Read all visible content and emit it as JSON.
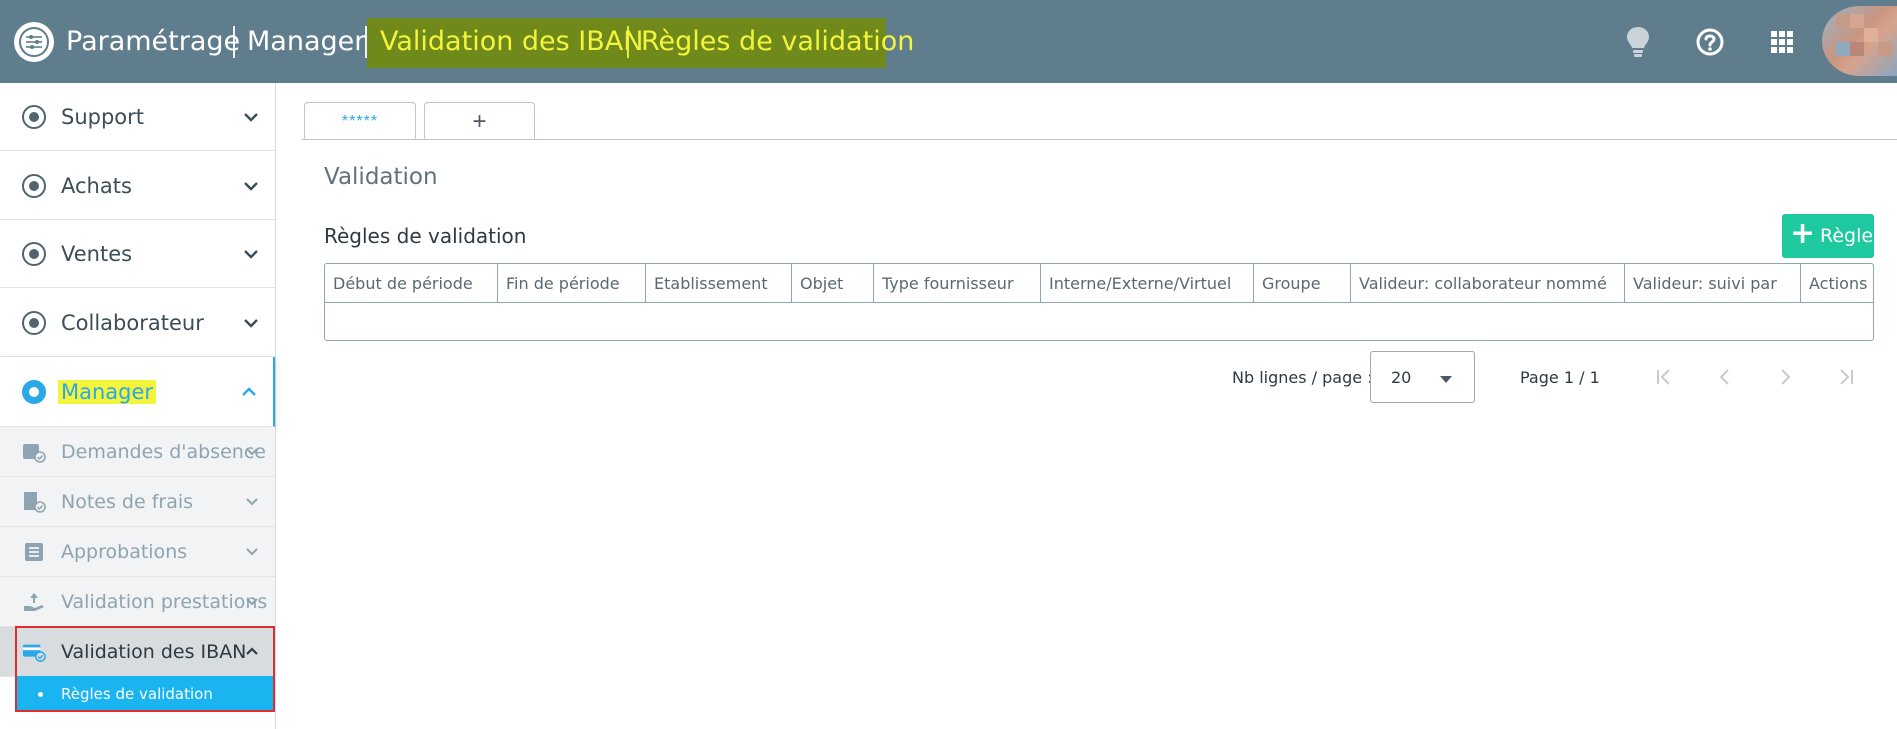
{
  "header": {
    "breadcrumbs": [
      "Paramétrage",
      "Manager",
      "Validation des IBAN",
      "Règles de validation"
    ],
    "icons": [
      "settings-logo-icon",
      "lightbulb-icon",
      "help-icon",
      "apps-grid-icon"
    ]
  },
  "sidebar": {
    "items": [
      {
        "label": "Support",
        "icon": "support-icon"
      },
      {
        "label": "Achats",
        "icon": "purchases-icon"
      },
      {
        "label": "Ventes",
        "icon": "sales-icon"
      },
      {
        "label": "Collaborateur",
        "icon": "user-icon"
      },
      {
        "label": "Manager",
        "icon": "manager-icon"
      }
    ],
    "subitems": [
      {
        "label": "Demandes d'absence",
        "icon": "calendar-check-icon"
      },
      {
        "label": "Notes de frais",
        "icon": "receipt-check-icon"
      },
      {
        "label": "Approbations",
        "icon": "checklist-icon"
      },
      {
        "label": "Validation prestations",
        "icon": "hand-upload-icon"
      },
      {
        "label": "Validation des IBAN",
        "icon": "card-check-icon"
      }
    ],
    "active_leaf": "Règles de validation"
  },
  "tabs": {
    "active": "*****",
    "add": "+"
  },
  "main": {
    "title": "Validation",
    "section": "Règles de validation",
    "add_button": "Règle"
  },
  "grid": {
    "columns": [
      "Début de période",
      "Fin de période",
      "Etablissement",
      "Objet",
      "Type fournisseur",
      "Interne/Externe/Virtuel",
      "Groupe",
      "Valideur: collaborateur nommé",
      "Valideur: suivi par",
      "Actions"
    ],
    "rows": []
  },
  "pager": {
    "label": "Nb lignes / page :",
    "page_size": "20",
    "page_info": "Page 1 / 1"
  },
  "colors": {
    "header_bg": "#5f7d8c",
    "highlight_bg": "#6f8a1a",
    "highlight_text": "#f3f43c",
    "accent": "#2aa8e8",
    "add_button": "#1ec9a0",
    "active_leaf_bg": "#1ab4f0"
  }
}
